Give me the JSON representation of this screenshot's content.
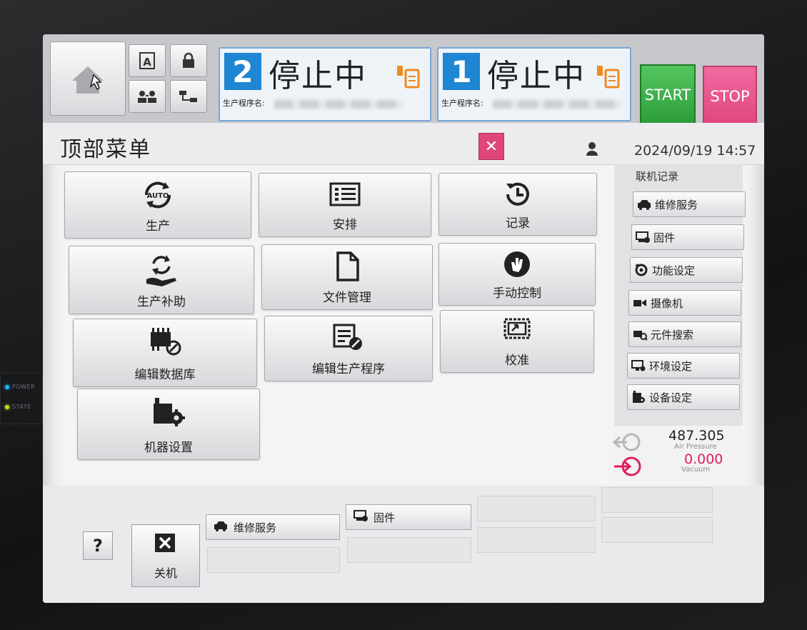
{
  "bezel": {
    "leds": [
      {
        "label": "POWER",
        "color": "#19b9ff"
      },
      {
        "label": "STATE",
        "color": "#c8e020"
      }
    ]
  },
  "header": {
    "panels": [
      {
        "number": "2",
        "status": "停止中",
        "program_label": "生产程序名:"
      },
      {
        "number": "1",
        "status": "停止中",
        "program_label": "生产程序名:"
      }
    ],
    "start_label": "START",
    "stop_label": "STOP",
    "small_icons": [
      "a-box-icon",
      "lock-icon",
      "users-icon",
      "network-icon"
    ]
  },
  "titlebar": {
    "title": "顶部菜单",
    "close_symbol": "✕",
    "datetime": "2024/09/19 14:57"
  },
  "menu": [
    {
      "label": "生产",
      "icon": "auto-cycle-icon"
    },
    {
      "label": "安排",
      "icon": "checklist-icon"
    },
    {
      "label": "记录",
      "icon": "history-icon"
    },
    {
      "label": "生产补助",
      "icon": "hand-cycle-icon"
    },
    {
      "label": "文件管理",
      "icon": "document-icon"
    },
    {
      "label": "手动控制",
      "icon": "manual-hand-icon"
    },
    {
      "label": "编辑数据库",
      "icon": "chip-edit-icon"
    },
    {
      "label": "编辑生产程序",
      "icon": "program-edit-icon"
    },
    {
      "label": "校准",
      "icon": "calibration-icon"
    },
    {
      "label": "机器设置",
      "icon": "machine-gear-icon"
    }
  ],
  "sidebar": {
    "header": "联机记录",
    "items": [
      {
        "label": "维修服务",
        "icon": "service-car-icon"
      },
      {
        "label": "固件",
        "icon": "firmware-icon"
      },
      {
        "label": "功能设定",
        "icon": "function-gear-icon"
      },
      {
        "label": "摄像机",
        "icon": "camera-icon"
      },
      {
        "label": "元件搜索",
        "icon": "part-search-icon"
      },
      {
        "label": "环境设定",
        "icon": "monitor-gear-icon"
      },
      {
        "label": "设备设定",
        "icon": "device-gear-icon"
      }
    ]
  },
  "gauges": {
    "air_pressure_value": "487.305",
    "air_pressure_label": "Air Pressure",
    "vacuum_value": "0.000",
    "vacuum_label": "Vacuum"
  },
  "bottom": {
    "help_label": "?",
    "shutdown_label": "关机",
    "quick": [
      {
        "label": "维修服务",
        "icon": "service-car-icon"
      },
      {
        "label": "固件",
        "icon": "firmware-icon"
      }
    ]
  }
}
